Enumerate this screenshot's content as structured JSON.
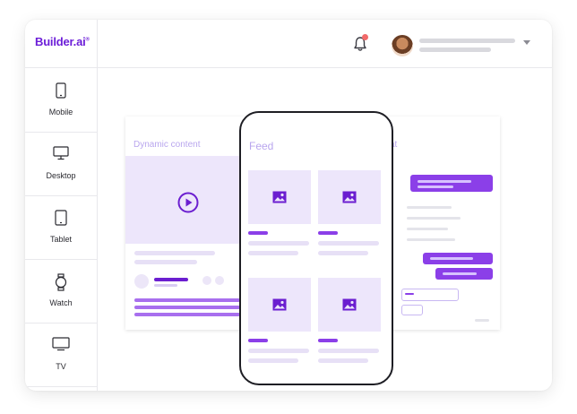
{
  "app": {
    "logo_text": "Builder.ai",
    "logo_mark": "®",
    "brand_color": "#6c1ed8"
  },
  "header": {
    "notification_icon": "bell-icon",
    "notification_badge_color": "#f26a6a",
    "account_dropdown_icon": "chevron-down-icon"
  },
  "sidebar": {
    "items": [
      {
        "label": "Mobile",
        "icon": "mobile-icon"
      },
      {
        "label": "Desktop",
        "icon": "desktop-icon"
      },
      {
        "label": "Tablet",
        "icon": "tablet-icon"
      },
      {
        "label": "Watch",
        "icon": "watch-icon"
      },
      {
        "label": "TV",
        "icon": "tv-icon"
      }
    ]
  },
  "previews": {
    "left_panel_title": "Dynamic content",
    "phone_title": "Feed",
    "right_panel_title": "at",
    "accent": "#8b3fe8",
    "tile_bg": "#ede6fb"
  }
}
